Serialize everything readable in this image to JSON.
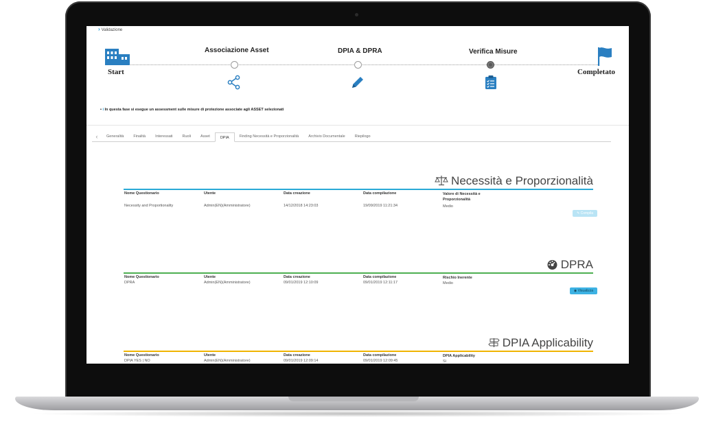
{
  "breadcrumb": {
    "label": "Validazione"
  },
  "stepper": {
    "start": "Start",
    "end": "Completato",
    "steps": [
      {
        "label": "Associazione Asset",
        "icon": "share-icon",
        "state": "done"
      },
      {
        "label": "DPIA & DPRA",
        "icon": "pencil-icon",
        "state": "done"
      },
      {
        "label": "Verifica Misure",
        "icon": "clipboard-icon",
        "state": "active"
      }
    ]
  },
  "info_text": "In questa fase si esegue un assessment sulle misure di protezione associate agli ASSET selezionati",
  "tabs": [
    "Generalità",
    "Finalità",
    "Interessati",
    "Ruoli",
    "Asset",
    "DPIA",
    "Finding Necessità e Proporzionalità",
    "Archivio Documentale",
    "Riepilogo"
  ],
  "active_tab": "DPIA",
  "sections": {
    "necessita": {
      "title": "Necessità e Proporzionalità",
      "icon": "scale-icon",
      "color": "#29a9d6",
      "headers": [
        "Nome Questionario",
        "Utente",
        "Data creazione",
        "Data compilazione",
        "Valore di Necessità e Proporzionalità"
      ],
      "row": [
        "Necessity and Proportionality",
        "Admin(EN)(Amministratore)",
        "14/12/2018 14:23:03",
        "19/09/2019 11:21:34",
        "Medio"
      ],
      "button": "Compila"
    },
    "dpra": {
      "title": "DPRA",
      "icon": "gauge-icon",
      "color": "#4caf50",
      "headers": [
        "Nome Questionario",
        "Utente",
        "Data creazione",
        "Data compilazione",
        "Rischio Inerente"
      ],
      "row": [
        "DPRA",
        "Admin(EN)(Amministratore)",
        "09/01/2019 12:10:09",
        "09/01/2019 12:11:17",
        "Medio"
      ],
      "button": "Visualizza"
    },
    "dpia": {
      "title": "DPIA Applicability",
      "icon": "signpost-icon",
      "color": "#f0b400",
      "headers": [
        "Nome Questionario",
        "Utente",
        "Data creazione",
        "Data compilazione",
        "DPIA Applicability"
      ],
      "row": [
        "DPIA YES | NO",
        "Admin(EN)(Amministratore)",
        "09/01/2019 12:09:14",
        "09/01/2019 12:09:45",
        "Sì"
      ]
    }
  }
}
